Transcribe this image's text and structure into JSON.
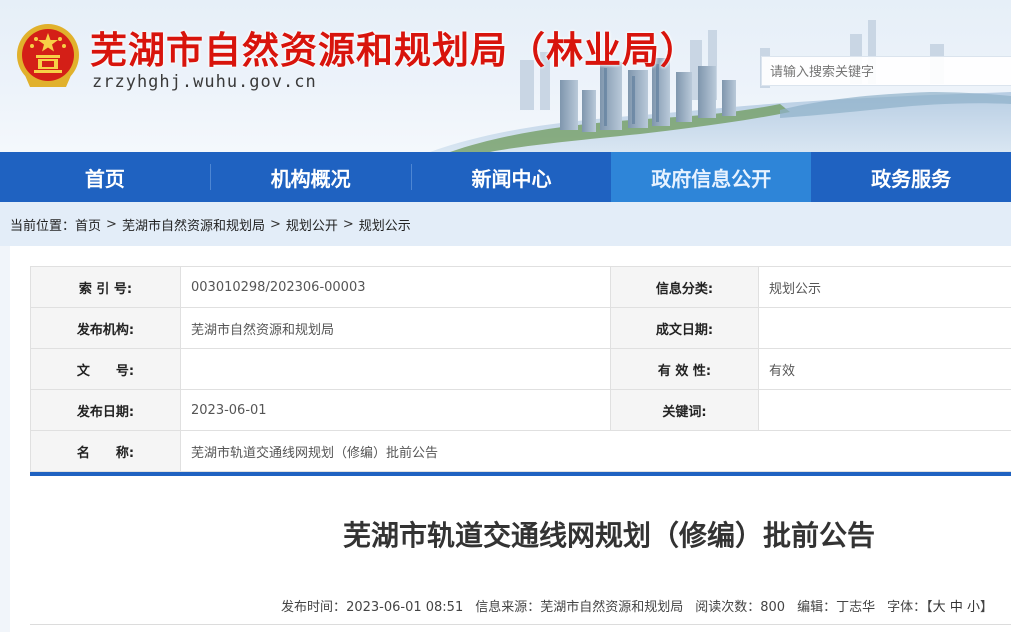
{
  "header": {
    "title": "芜湖市自然资源和规划局（林业局）",
    "domain": "zrzyhghj.wuhu.gov.cn",
    "emblem_icon": "national-emblem-icon",
    "search_placeholder": "请输入搜索关键字"
  },
  "nav": {
    "items": [
      {
        "label": "首页"
      },
      {
        "label": "机构概况"
      },
      {
        "label": "新闻中心"
      },
      {
        "label": "政府信息公开",
        "active": true
      },
      {
        "label": "政务服务"
      }
    ]
  },
  "breadcrumb": {
    "prefix": "当前位置：",
    "items": [
      "首页",
      "芜湖市自然资源和规划局",
      "规划公开",
      "规划公示"
    ],
    "separator": ">"
  },
  "info": {
    "index_label": "索 引 号:",
    "index_value": "003010298/202306-00003",
    "category_label": "信息分类:",
    "category_value": "规划公示",
    "publisher_label": "发布机构:",
    "publisher_value": "芜湖市自然资源和规划局",
    "created_label": "成文日期:",
    "created_value": "",
    "docno_label": "文　　号:",
    "docno_value": "",
    "validity_label": "有 效 性:",
    "validity_value": "有效",
    "pubdate_label": "发布日期:",
    "pubdate_value": "2023-06-01",
    "keywords_label": "关键词:",
    "keywords_value": "",
    "name_label": "名　　称:",
    "name_value": "芜湖市轨道交通线网规划（修编）批前公告"
  },
  "article": {
    "title": "芜湖市轨道交通线网规划（修编）批前公告",
    "publish_time_label": "发布时间：",
    "publish_time": "2023-06-01 08:51",
    "source_label": "信息来源：",
    "source": "芜湖市自然资源和规划局",
    "views_label": "阅读次数：",
    "views": "800",
    "editor_label": "编辑：",
    "editor": "丁志华",
    "font_label": "字体：",
    "font_open": "【",
    "font_large": "大",
    "font_medium": "中",
    "font_small": "小",
    "font_close": "】"
  },
  "colors": {
    "title_red": "#d8140c",
    "nav_blue": "#1f62c1",
    "nav_active": "#2e85d8",
    "crumb_bg": "#e3edf8"
  }
}
